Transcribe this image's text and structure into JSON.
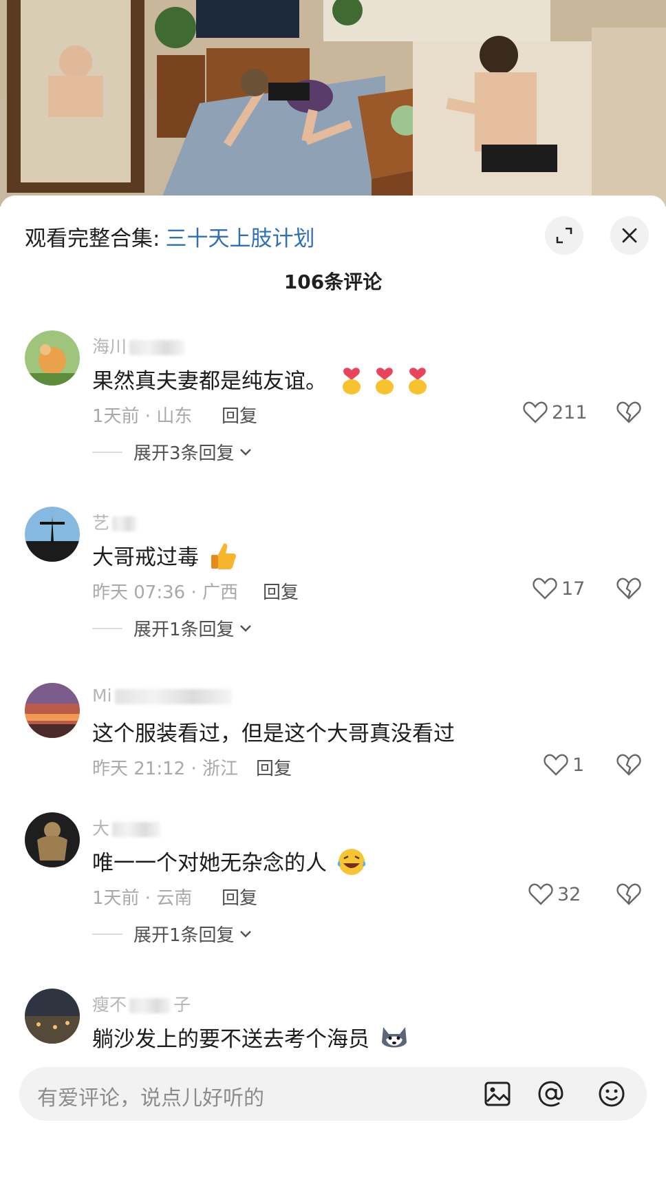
{
  "header": {
    "collection_prefix": "观看完整合集:",
    "collection_link": "三十天上肢计划"
  },
  "comment_count": "106条评论",
  "comments": [
    {
      "username": "海川",
      "text": "果然真夫妻都是纯友谊。",
      "emoji": "finger-heart-emoji",
      "meta": "1天前 · 山东",
      "reply_label": "回复",
      "likes": "211",
      "expand": "展开3条回复"
    },
    {
      "username": "艺",
      "text": "大哥戒过毒",
      "emoji": "thumbs-up-emoji",
      "meta": "昨天 07:36 · 广西",
      "reply_label": "回复",
      "likes": "17",
      "expand": "展开1条回复"
    },
    {
      "username": "Mi",
      "text": "这个服装看过，但是这个大哥真没看过",
      "meta": "昨天 21:12 · 浙江",
      "reply_label": "回复",
      "likes": "1"
    },
    {
      "username": "大",
      "text": "唯一一个对她无杂念的人",
      "emoji": "laughing-crying-emoji",
      "meta": "1天前 · 云南",
      "reply_label": "回复",
      "likes": "32",
      "expand": "展开1条回复"
    },
    {
      "username": "瘦不",
      "username_suffix": "子",
      "text": "躺沙发上的要不送去考个海员",
      "emoji": "husky-emoji"
    }
  ],
  "input": {
    "placeholder": "有爱评论，说点儿好听的"
  },
  "colors": {
    "link": "#2f6fba",
    "meta": "#a9a9a9",
    "text": "#1c1c1c"
  }
}
